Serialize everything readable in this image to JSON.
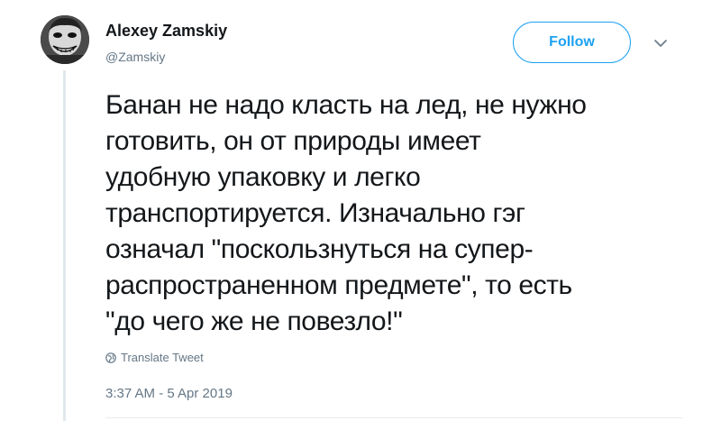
{
  "author": {
    "name": "Alexey Zamskiy",
    "handle": "@Zamskiy"
  },
  "follow_button": {
    "label": "Follow"
  },
  "tweet": {
    "text": "Банан не надо класть на лед, не нужно\nготовить, он от природы имеет\nудобную упаковку и легко\nтранспортируется. Изначально гэг\nозначал \"поскользнуться на супер-\nраспространенном предмете\", то есть\n\"до чего же не повезло!\"",
    "translate_label": "Translate Tweet",
    "timestamp": "3:37 AM - 5 Apr 2019"
  },
  "icons": {
    "caret": "chevron-down-icon",
    "translate": "globe-icon"
  },
  "colors": {
    "accent": "#1da1f2",
    "secondary_text": "#657786",
    "primary_text": "#14171a",
    "thread_line": "#e1e8ed"
  }
}
